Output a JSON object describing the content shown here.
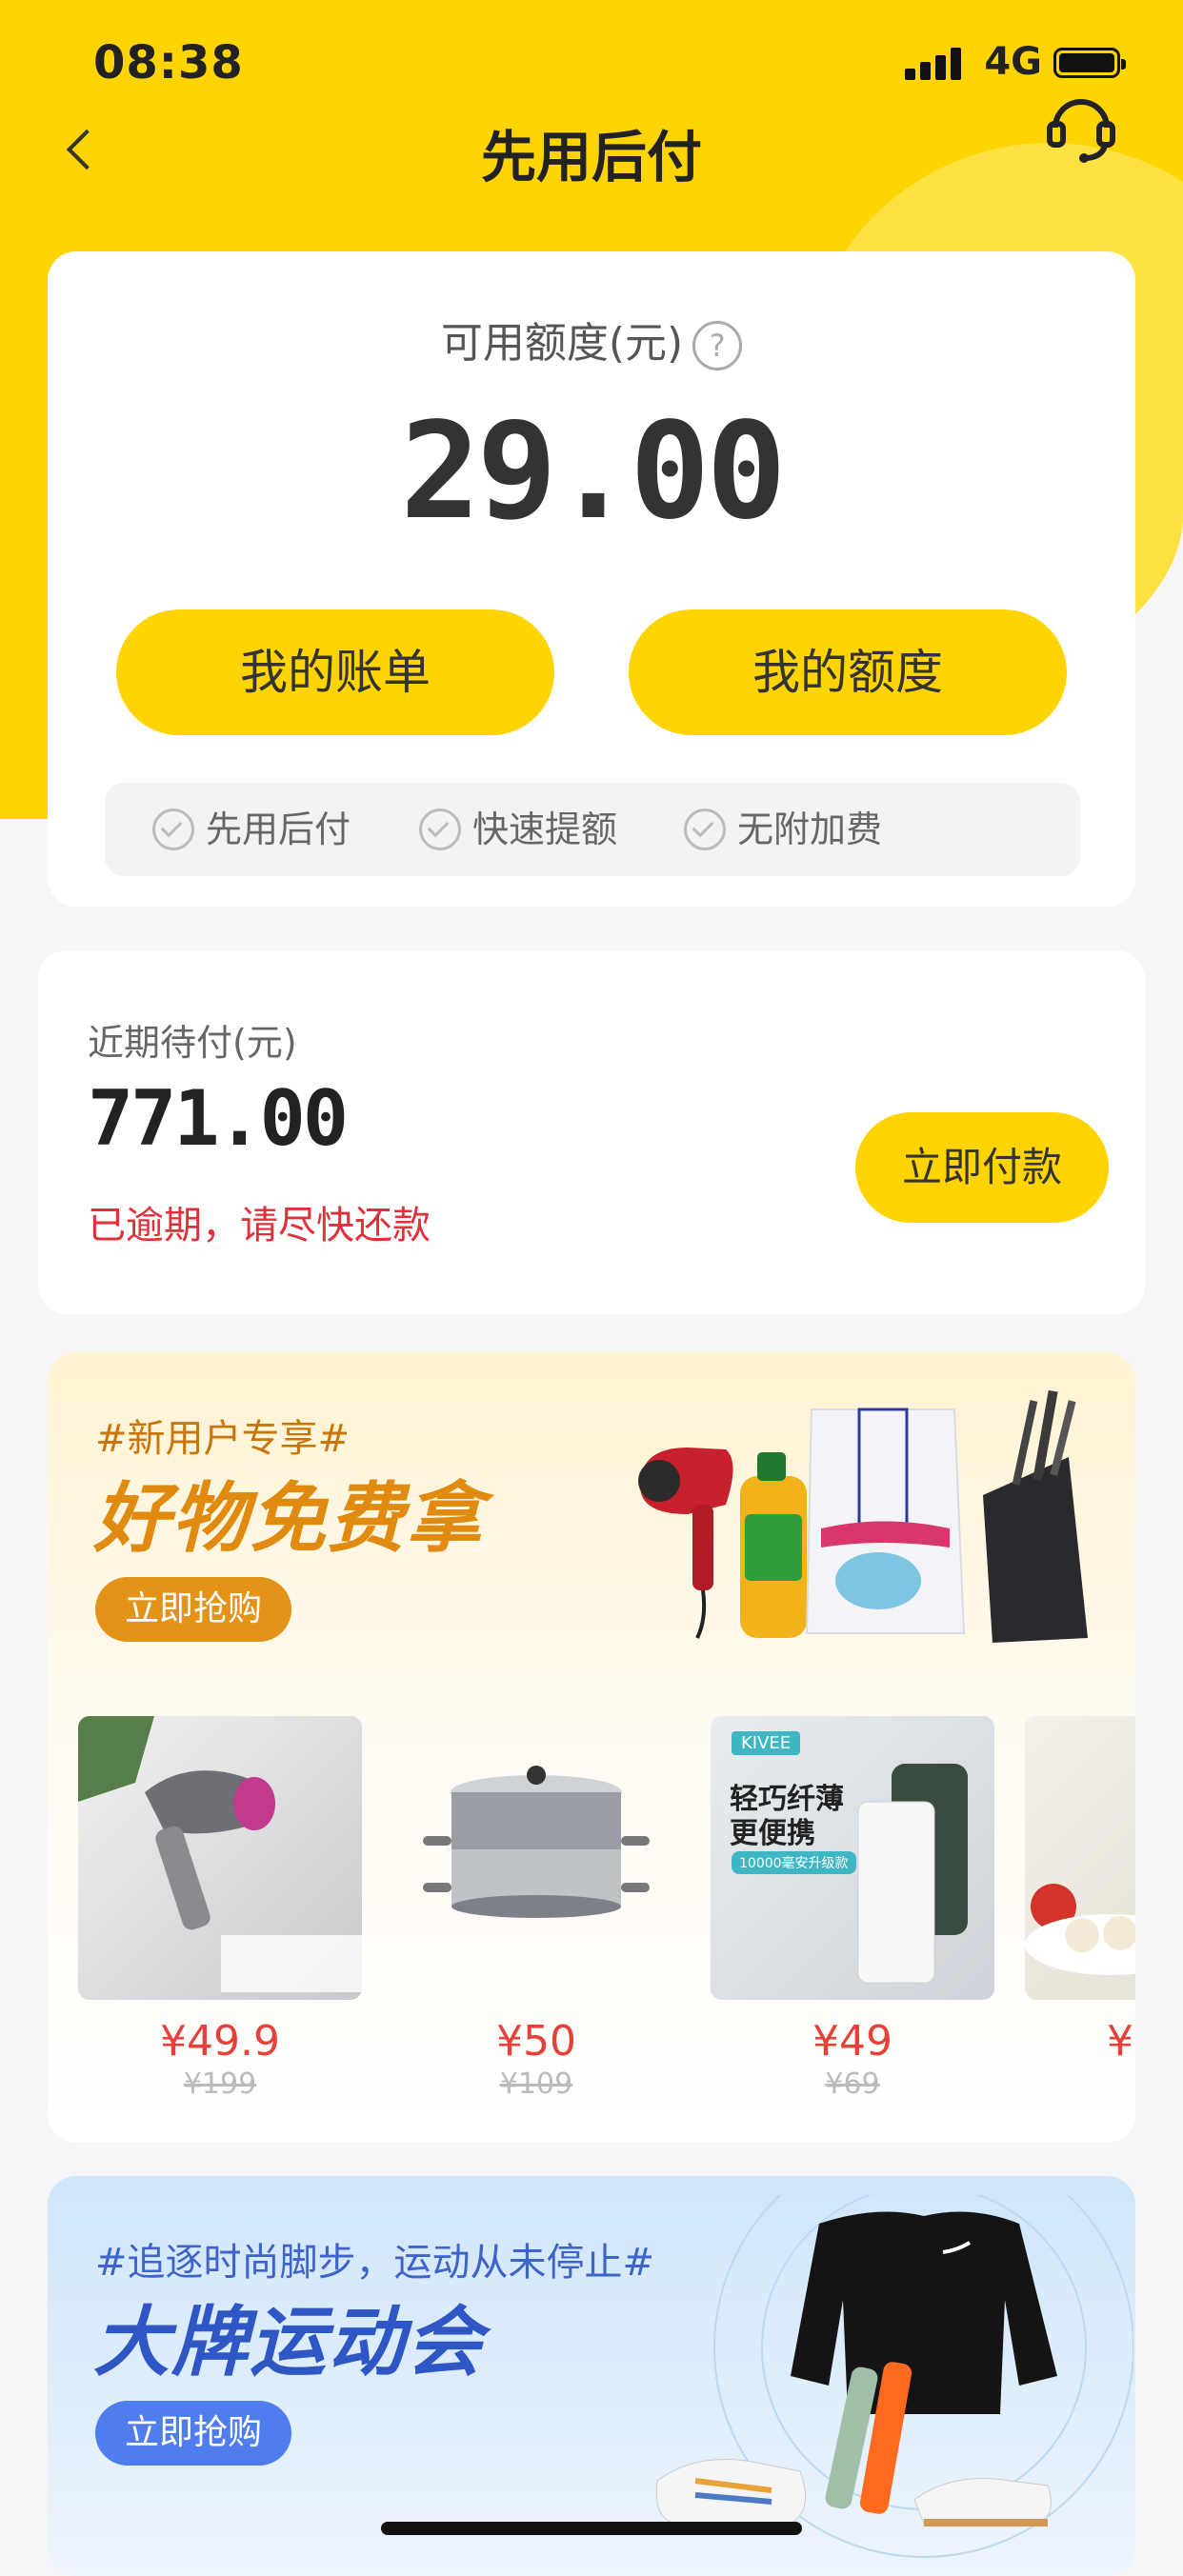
{
  "status": {
    "time": "08:38",
    "network": "4G"
  },
  "nav": {
    "title": "先用后付"
  },
  "credit": {
    "label": "可用额度(元)",
    "help": "?",
    "amount": "29.00",
    "bill_button": "我的账单",
    "quota_button": "我的额度",
    "features": [
      "先用后付",
      "快速提额",
      "无附加费"
    ]
  },
  "payment": {
    "label": "近期待付(元)",
    "amount": "771.00",
    "warning": "已逾期，请尽快还款",
    "pay_button": "立即付款"
  },
  "promo1": {
    "tag": "#新用户专享#",
    "title": "好物免费拿",
    "button": "立即抢购",
    "products": [
      {
        "price": "¥49.9",
        "original": "¥199",
        "image": "hair-dryer"
      },
      {
        "price": "¥50",
        "original": "¥109",
        "image": "steamer-pot"
      },
      {
        "price": "¥49",
        "original": "¥69",
        "image": "power-bank",
        "brand": "KIVEE",
        "caption1": "轻巧纤薄",
        "caption2": "更便携",
        "caption3": "10000毫安升级款"
      },
      {
        "price": "¥",
        "original": "",
        "image": "food-plate"
      }
    ]
  },
  "promo2": {
    "tag": "#追逐时尚脚步，运动从未停止#",
    "title": "大牌运动会",
    "button": "立即抢购"
  },
  "colors": {
    "brand": "#FFD400",
    "warning": "#e0303a",
    "price": "#e5413a"
  }
}
